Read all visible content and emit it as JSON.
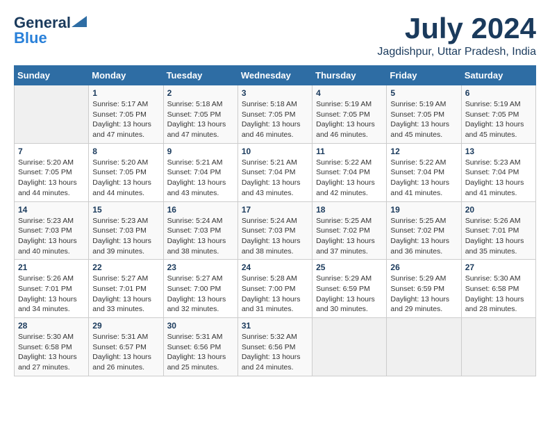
{
  "header": {
    "logo_general": "General",
    "logo_blue": "Blue",
    "month_year": "July 2024",
    "location": "Jagdishpur, Uttar Pradesh, India"
  },
  "weekdays": [
    "Sunday",
    "Monday",
    "Tuesday",
    "Wednesday",
    "Thursday",
    "Friday",
    "Saturday"
  ],
  "weeks": [
    [
      {
        "day": "",
        "sunrise": "",
        "sunset": "",
        "daylight": ""
      },
      {
        "day": "1",
        "sunrise": "Sunrise: 5:17 AM",
        "sunset": "Sunset: 7:05 PM",
        "daylight": "Daylight: 13 hours and 47 minutes."
      },
      {
        "day": "2",
        "sunrise": "Sunrise: 5:18 AM",
        "sunset": "Sunset: 7:05 PM",
        "daylight": "Daylight: 13 hours and 47 minutes."
      },
      {
        "day": "3",
        "sunrise": "Sunrise: 5:18 AM",
        "sunset": "Sunset: 7:05 PM",
        "daylight": "Daylight: 13 hours and 46 minutes."
      },
      {
        "day": "4",
        "sunrise": "Sunrise: 5:19 AM",
        "sunset": "Sunset: 7:05 PM",
        "daylight": "Daylight: 13 hours and 46 minutes."
      },
      {
        "day": "5",
        "sunrise": "Sunrise: 5:19 AM",
        "sunset": "Sunset: 7:05 PM",
        "daylight": "Daylight: 13 hours and 45 minutes."
      },
      {
        "day": "6",
        "sunrise": "Sunrise: 5:19 AM",
        "sunset": "Sunset: 7:05 PM",
        "daylight": "Daylight: 13 hours and 45 minutes."
      }
    ],
    [
      {
        "day": "7",
        "sunrise": "Sunrise: 5:20 AM",
        "sunset": "Sunset: 7:05 PM",
        "daylight": "Daylight: 13 hours and 44 minutes."
      },
      {
        "day": "8",
        "sunrise": "Sunrise: 5:20 AM",
        "sunset": "Sunset: 7:05 PM",
        "daylight": "Daylight: 13 hours and 44 minutes."
      },
      {
        "day": "9",
        "sunrise": "Sunrise: 5:21 AM",
        "sunset": "Sunset: 7:04 PM",
        "daylight": "Daylight: 13 hours and 43 minutes."
      },
      {
        "day": "10",
        "sunrise": "Sunrise: 5:21 AM",
        "sunset": "Sunset: 7:04 PM",
        "daylight": "Daylight: 13 hours and 43 minutes."
      },
      {
        "day": "11",
        "sunrise": "Sunrise: 5:22 AM",
        "sunset": "Sunset: 7:04 PM",
        "daylight": "Daylight: 13 hours and 42 minutes."
      },
      {
        "day": "12",
        "sunrise": "Sunrise: 5:22 AM",
        "sunset": "Sunset: 7:04 PM",
        "daylight": "Daylight: 13 hours and 41 minutes."
      },
      {
        "day": "13",
        "sunrise": "Sunrise: 5:23 AM",
        "sunset": "Sunset: 7:04 PM",
        "daylight": "Daylight: 13 hours and 41 minutes."
      }
    ],
    [
      {
        "day": "14",
        "sunrise": "Sunrise: 5:23 AM",
        "sunset": "Sunset: 7:03 PM",
        "daylight": "Daylight: 13 hours and 40 minutes."
      },
      {
        "day": "15",
        "sunrise": "Sunrise: 5:23 AM",
        "sunset": "Sunset: 7:03 PM",
        "daylight": "Daylight: 13 hours and 39 minutes."
      },
      {
        "day": "16",
        "sunrise": "Sunrise: 5:24 AM",
        "sunset": "Sunset: 7:03 PM",
        "daylight": "Daylight: 13 hours and 38 minutes."
      },
      {
        "day": "17",
        "sunrise": "Sunrise: 5:24 AM",
        "sunset": "Sunset: 7:03 PM",
        "daylight": "Daylight: 13 hours and 38 minutes."
      },
      {
        "day": "18",
        "sunrise": "Sunrise: 5:25 AM",
        "sunset": "Sunset: 7:02 PM",
        "daylight": "Daylight: 13 hours and 37 minutes."
      },
      {
        "day": "19",
        "sunrise": "Sunrise: 5:25 AM",
        "sunset": "Sunset: 7:02 PM",
        "daylight": "Daylight: 13 hours and 36 minutes."
      },
      {
        "day": "20",
        "sunrise": "Sunrise: 5:26 AM",
        "sunset": "Sunset: 7:01 PM",
        "daylight": "Daylight: 13 hours and 35 minutes."
      }
    ],
    [
      {
        "day": "21",
        "sunrise": "Sunrise: 5:26 AM",
        "sunset": "Sunset: 7:01 PM",
        "daylight": "Daylight: 13 hours and 34 minutes."
      },
      {
        "day": "22",
        "sunrise": "Sunrise: 5:27 AM",
        "sunset": "Sunset: 7:01 PM",
        "daylight": "Daylight: 13 hours and 33 minutes."
      },
      {
        "day": "23",
        "sunrise": "Sunrise: 5:27 AM",
        "sunset": "Sunset: 7:00 PM",
        "daylight": "Daylight: 13 hours and 32 minutes."
      },
      {
        "day": "24",
        "sunrise": "Sunrise: 5:28 AM",
        "sunset": "Sunset: 7:00 PM",
        "daylight": "Daylight: 13 hours and 31 minutes."
      },
      {
        "day": "25",
        "sunrise": "Sunrise: 5:29 AM",
        "sunset": "Sunset: 6:59 PM",
        "daylight": "Daylight: 13 hours and 30 minutes."
      },
      {
        "day": "26",
        "sunrise": "Sunrise: 5:29 AM",
        "sunset": "Sunset: 6:59 PM",
        "daylight": "Daylight: 13 hours and 29 minutes."
      },
      {
        "day": "27",
        "sunrise": "Sunrise: 5:30 AM",
        "sunset": "Sunset: 6:58 PM",
        "daylight": "Daylight: 13 hours and 28 minutes."
      }
    ],
    [
      {
        "day": "28",
        "sunrise": "Sunrise: 5:30 AM",
        "sunset": "Sunset: 6:58 PM",
        "daylight": "Daylight: 13 hours and 27 minutes."
      },
      {
        "day": "29",
        "sunrise": "Sunrise: 5:31 AM",
        "sunset": "Sunset: 6:57 PM",
        "daylight": "Daylight: 13 hours and 26 minutes."
      },
      {
        "day": "30",
        "sunrise": "Sunrise: 5:31 AM",
        "sunset": "Sunset: 6:56 PM",
        "daylight": "Daylight: 13 hours and 25 minutes."
      },
      {
        "day": "31",
        "sunrise": "Sunrise: 5:32 AM",
        "sunset": "Sunset: 6:56 PM",
        "daylight": "Daylight: 13 hours and 24 minutes."
      },
      {
        "day": "",
        "sunrise": "",
        "sunset": "",
        "daylight": ""
      },
      {
        "day": "",
        "sunrise": "",
        "sunset": "",
        "daylight": ""
      },
      {
        "day": "",
        "sunrise": "",
        "sunset": "",
        "daylight": ""
      }
    ]
  ]
}
